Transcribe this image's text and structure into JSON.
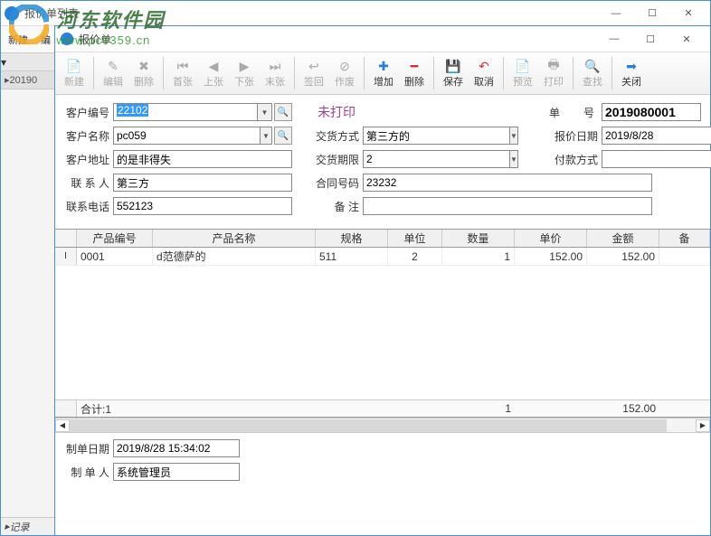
{
  "outer": {
    "title": "报价单列表",
    "toolbar": {
      "new": "新建",
      "edit": "编"
    },
    "left_col_hdr": "",
    "left_row": "20190"
  },
  "inner": {
    "title": "报价单",
    "win_min": "—",
    "win_max": "☐",
    "win_close": "✕"
  },
  "toolbar": {
    "new": "新建",
    "edit": "编辑",
    "delete": "删除",
    "first": "首张",
    "prev": "上张",
    "next": "下张",
    "last": "末张",
    "signin": "签回",
    "void": "作废",
    "add": "增加",
    "del": "删除",
    "save": "保存",
    "cancel": "取消",
    "preview": "预览",
    "print": "打印",
    "find": "查找",
    "close": "关闭"
  },
  "form": {
    "cust_no_lbl": "客户编号",
    "cust_no": "22102",
    "status": "未打印",
    "order_no_lbl_a": "单",
    "order_no_lbl_b": "号",
    "order_no": "2019080001",
    "cust_name_lbl": "客户名称",
    "cust_name": "pc059",
    "delivery_method_lbl": "交货方式",
    "delivery_method": "第三方的",
    "quote_date_lbl": "报价日期",
    "quote_date": "2019/8/28",
    "cust_addr_lbl": "客户地址",
    "cust_addr": "的是非得失",
    "delivery_time_lbl": "交货期限",
    "delivery_time": "2",
    "pay_method_lbl": "付款方式",
    "pay_method": "",
    "contact_lbl": "联 系 人",
    "contact": "第三方",
    "contract_no_lbl": "合同号码",
    "contract_no": "23232",
    "phone_lbl": "联系电话",
    "phone": "552123",
    "remark_lbl": "备    注",
    "remark": ""
  },
  "grid": {
    "headers": {
      "code": "产品编号",
      "name": "产品名称",
      "spec": "规格",
      "unit": "单位",
      "qty": "数量",
      "price": "单价",
      "amount": "金额",
      "note": "备"
    },
    "rows": [
      {
        "code": "0001",
        "name": "d范德萨的",
        "spec": "511",
        "unit": "2",
        "qty": "1",
        "price": "152.00",
        "amount": "152.00"
      }
    ],
    "footer": {
      "label": "合计:1",
      "qty": "1",
      "amount": "152.00"
    }
  },
  "bottom": {
    "make_date_lbl": "制单日期",
    "make_date": "2019/8/28 15:34:02",
    "maker_lbl": "制 单 人",
    "maker": "系统管理员"
  },
  "status": "记录",
  "watermark": {
    "title": "河东软件园",
    "url": "www.pc0359.cn"
  }
}
